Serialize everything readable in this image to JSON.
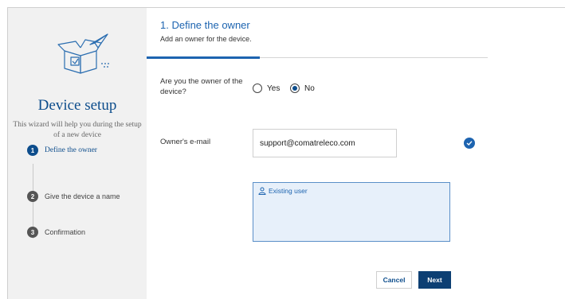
{
  "sidebar": {
    "title": "Device setup",
    "subtitle": "This wizard will help you during the setup of a new device",
    "illustration_icon": "package-paper-plane-icon",
    "steps": [
      {
        "number": "1",
        "label": "Define the owner",
        "active": true
      },
      {
        "number": "2",
        "label": "Give the device a name",
        "active": false
      },
      {
        "number": "3",
        "label": "Confirmation",
        "active": false
      }
    ]
  },
  "main": {
    "section_title": "1. Define the owner",
    "section_subtitle": "Add an owner for the device.",
    "owner_question": "Are you the owner of the device?",
    "radio_yes": "Yes",
    "radio_no": "No",
    "selected_option": "No",
    "email_label": "Owner's e-mail",
    "email_value": "support@comatreleco.com",
    "existing_user_label": "Existing user",
    "cancel_label": "Cancel",
    "next_label": "Next"
  },
  "colors": {
    "primary": "#0d4d8c",
    "accent": "#1d64b0",
    "sidebar_bg": "#f1f1f1",
    "next_button_bg": "#0d3f73"
  }
}
